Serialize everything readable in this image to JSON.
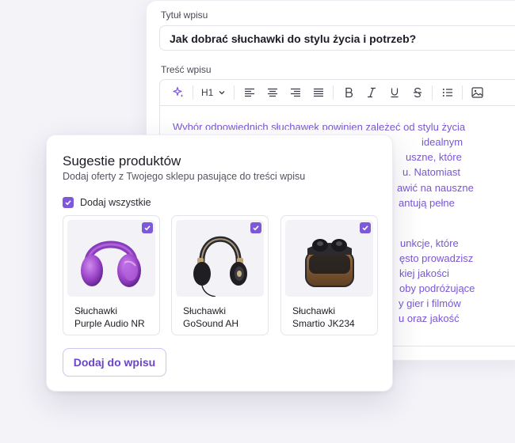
{
  "editor": {
    "title_label": "Tytuł wpisu",
    "title_value": "Jak dobrać słuchawki do stylu życia i potrzeb?",
    "content_label": "Treść wpisu",
    "heading_select": "H1",
    "content_lines": [
      "Wybór odpowiednich słuchawek powinien zależeć od stylu życia",
      "idealnym",
      "uszne, które",
      "u. Natomiast",
      "awić na nauszne",
      "antują pełne",
      "unkcje, które",
      "ęsto prowadzisz",
      "kiej jakości",
      "oby podróżujące",
      "y gier i filmów",
      "u oraz jakość"
    ]
  },
  "popup": {
    "title": "Sugestie produktów",
    "subtitle": "Dodaj oferty z Twojego sklepu pasujące do treści wpisu",
    "add_all_label": "Dodaj wszystkie",
    "add_button_label": "Dodaj do wpisu",
    "products": [
      {
        "name_line1": "Słuchawki",
        "name_line2": "Purple Audio NR"
      },
      {
        "name_line1": "Słuchawki",
        "name_line2": "GoSound AH"
      },
      {
        "name_line1": "Słuchawki",
        "name_line2": "Smartio JK234"
      }
    ]
  },
  "colors": {
    "accent": "#7d59d9",
    "content_text": "#7a56d6",
    "button_text": "#6a44cc"
  }
}
